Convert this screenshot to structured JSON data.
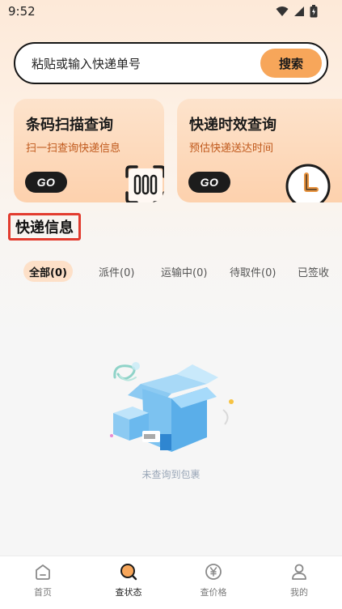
{
  "status_bar": {
    "time": "9:52"
  },
  "search": {
    "placeholder": "粘贴或输入快递单号",
    "button_label": "搜索"
  },
  "cards": [
    {
      "title": "条码扫描查询",
      "subtitle": "扫一扫查询快递信息",
      "go_label": "GO",
      "icon": "barcode-scan-icon"
    },
    {
      "title": "快递时效查询",
      "subtitle": "预估快递送达时间",
      "go_label": "GO",
      "icon": "clock-icon"
    }
  ],
  "section_title": "快递信息",
  "tabs": [
    {
      "label": "全部(0)",
      "active": true
    },
    {
      "label": "派件(0)",
      "active": false
    },
    {
      "label": "运输中(0)",
      "active": false
    },
    {
      "label": "待取件(0)",
      "active": false
    },
    {
      "label": "已签收",
      "active": false
    }
  ],
  "empty_state": {
    "text": "未查询到包裹",
    "illustration": "open-box-icon"
  },
  "bottom_nav": [
    {
      "label": "首页",
      "icon": "home-icon",
      "active": false
    },
    {
      "label": "查状态",
      "icon": "search-status-icon",
      "active": true
    },
    {
      "label": "查价格",
      "icon": "yuan-icon",
      "active": false
    },
    {
      "label": "我的",
      "icon": "profile-icon",
      "active": false
    }
  ],
  "colors": {
    "accent": "#f7a65a",
    "highlight_border": "#e23c2f",
    "card_bg": "#fdd9bc",
    "subtitle": "#c0591c"
  }
}
